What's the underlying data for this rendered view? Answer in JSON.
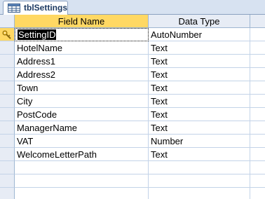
{
  "tab": {
    "icon": "table-icon",
    "label": "tblSettings"
  },
  "columns": {
    "field_name": "Field Name",
    "data_type": "Data Type"
  },
  "rows": [
    {
      "field": "SettingID",
      "type": "AutoNumber",
      "primary_key": true,
      "selected": true
    },
    {
      "field": "HotelName",
      "type": "Text"
    },
    {
      "field": "Address1",
      "type": "Text"
    },
    {
      "field": "Address2",
      "type": "Text"
    },
    {
      "field": "Town",
      "type": "Text"
    },
    {
      "field": "City",
      "type": "Text"
    },
    {
      "field": "PostCode",
      "type": "Text"
    },
    {
      "field": "ManagerName",
      "type": "Text"
    },
    {
      "field": "VAT",
      "type": "Number"
    },
    {
      "field": "WelcomeLetterPath",
      "type": "Text"
    },
    {
      "field": "",
      "type": ""
    },
    {
      "field": "",
      "type": ""
    },
    {
      "field": "",
      "type": ""
    }
  ],
  "colors": {
    "header_active": "#ffd863",
    "header": "#e7ecf5",
    "grid_line": "#c3d3e8",
    "tab_text": "#1e3b63"
  }
}
